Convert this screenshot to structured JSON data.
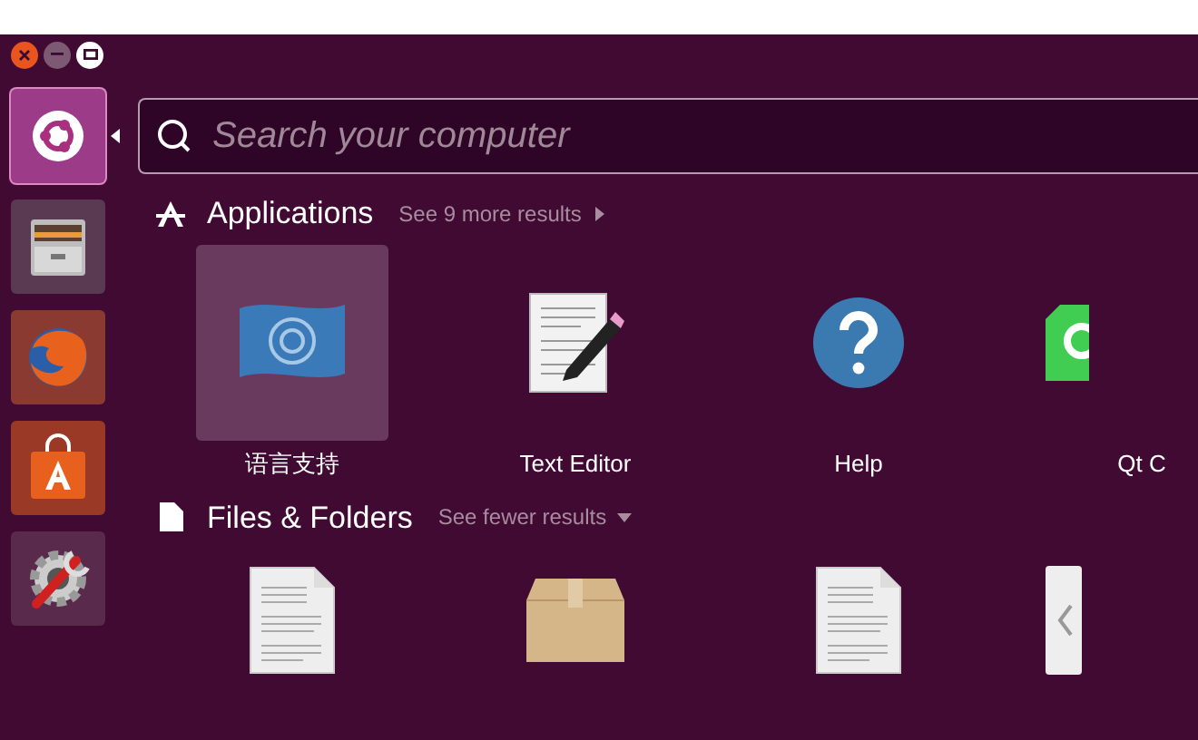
{
  "window_controls": [
    {
      "kind": "close"
    },
    {
      "kind": "minimize"
    },
    {
      "kind": "maximize"
    }
  ],
  "launcher": {
    "items": [
      {
        "kind": "dash",
        "selected": true
      },
      {
        "kind": "files",
        "selected": false
      },
      {
        "kind": "browser",
        "selected": false
      },
      {
        "kind": "store",
        "selected": false
      },
      {
        "kind": "settings",
        "selected": false
      }
    ]
  },
  "search": {
    "placeholder": "Search your computer"
  },
  "sections": [
    {
      "kind": "applications",
      "title": "Applications",
      "link": "See 9 more results",
      "expanded": false,
      "items": [
        {
          "kind": "language",
          "label": "语言支持",
          "selected": true
        },
        {
          "kind": "editor",
          "label": "Text Editor",
          "selected": false
        },
        {
          "kind": "help",
          "label": "Help",
          "selected": false
        },
        {
          "kind": "qt",
          "label": "Qt C",
          "selected": false
        }
      ]
    },
    {
      "kind": "files",
      "title": "Files & Folders",
      "link": "See fewer results",
      "expanded": true,
      "items": [
        {
          "kind": "text",
          "selected": false
        },
        {
          "kind": "package",
          "selected": false
        },
        {
          "kind": "text",
          "selected": false
        },
        {
          "kind": "partial",
          "selected": false
        }
      ]
    }
  ]
}
